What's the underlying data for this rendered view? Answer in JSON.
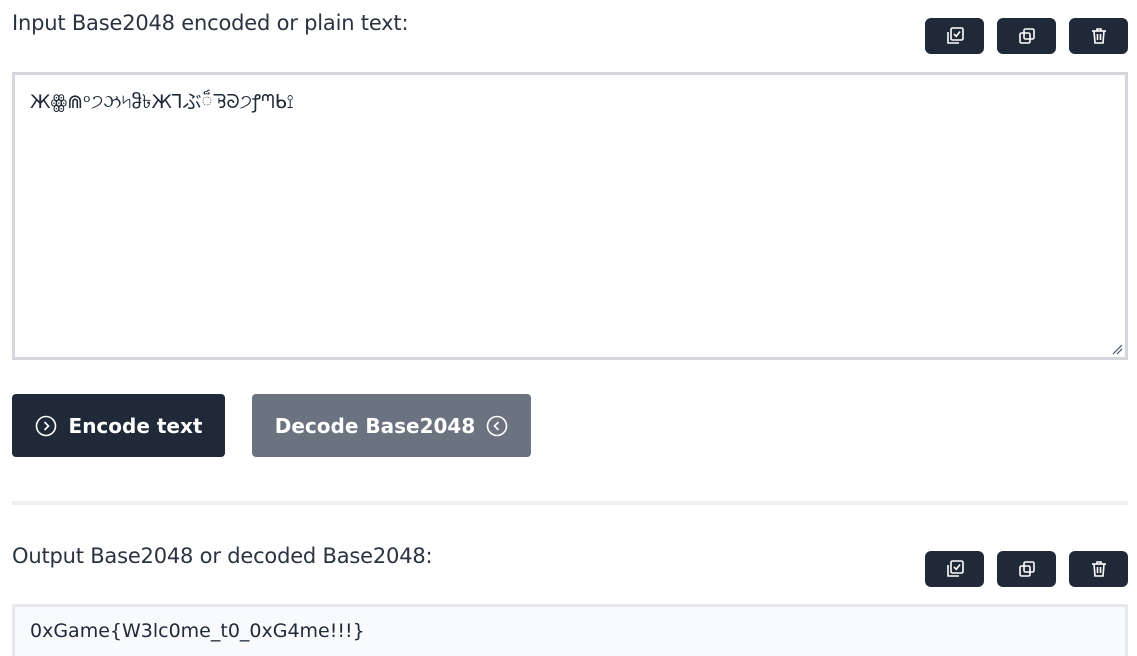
{
  "input_section": {
    "label": "Input Base2048 encoded or plain text:",
    "value": "Жꙮ⋒ᵒ੭ઝ৸ჵ৳Ж⅂ぶ៏ᘋᘐ੭ꝭᘉᑲ⟟"
  },
  "actions": {
    "encode_label": "Encode text",
    "decode_label": "Decode Base2048"
  },
  "output_section": {
    "label": "Output Base2048 or decoded Base2048:",
    "value": "0xGame{W3lc0me_t0_0xG4me!!!}"
  },
  "icons": {
    "select_all": "checkbox-select-icon",
    "copy": "copy-icon",
    "delete": "trash-icon",
    "encode": "chevron-right-circle-icon",
    "decode": "chevron-left-circle-icon"
  },
  "colors": {
    "primary": "#1f2937",
    "secondary": "#6b7280",
    "border": "#d4d6db"
  }
}
